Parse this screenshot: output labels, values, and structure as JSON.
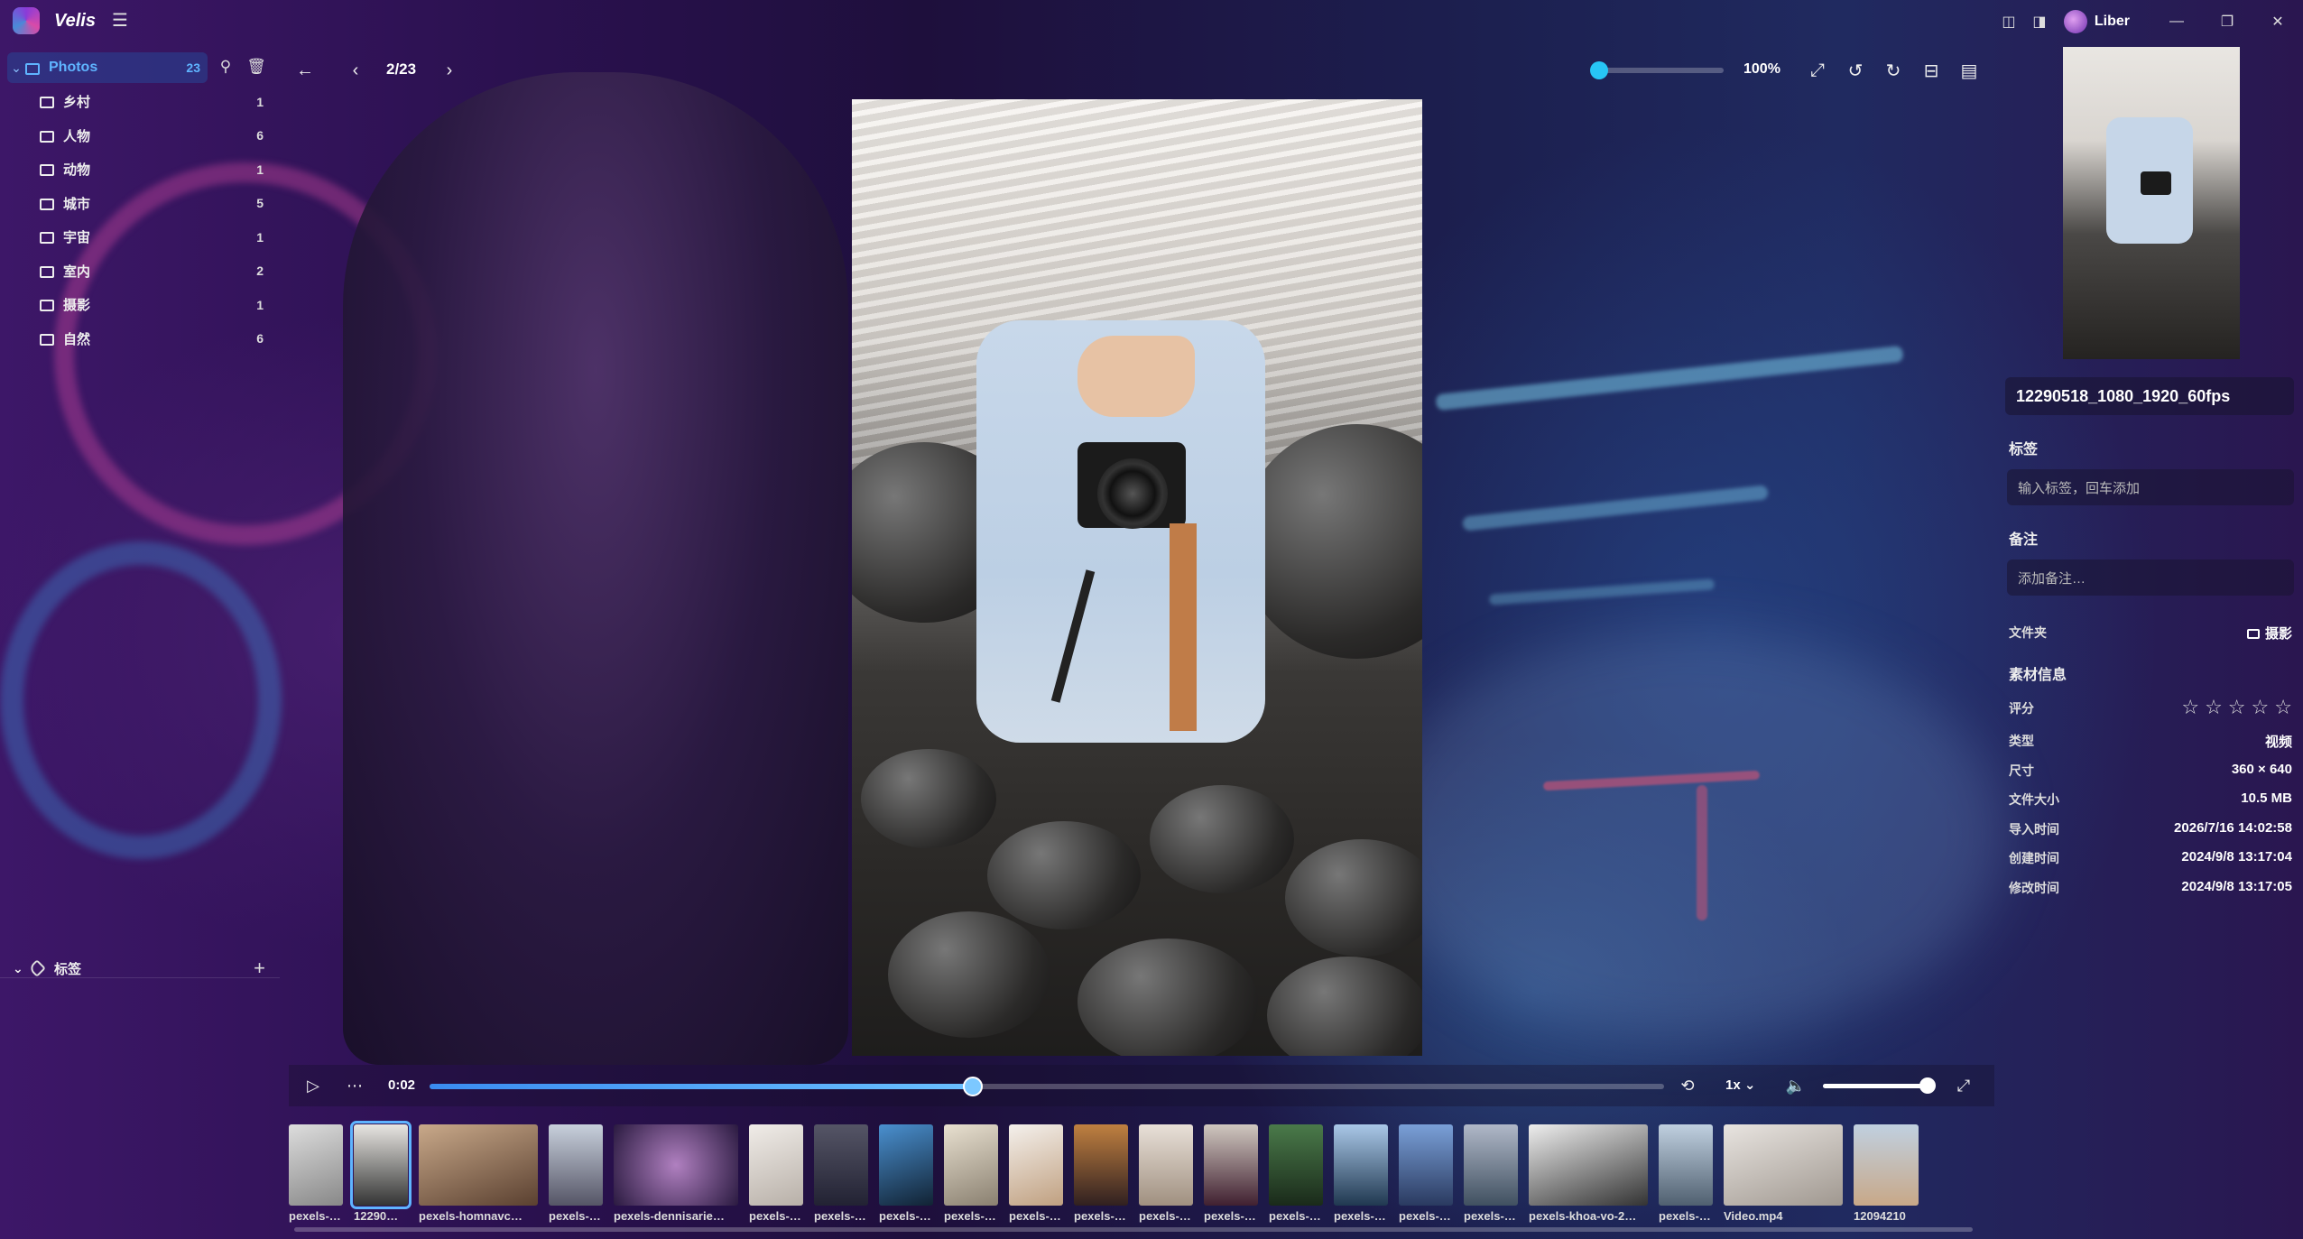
{
  "app": {
    "name": "Velis"
  },
  "user": {
    "name": "Liber"
  },
  "sidebar": {
    "root": {
      "label": "Photos",
      "count": "23"
    },
    "folders": [
      {
        "label": "乡村",
        "count": "1"
      },
      {
        "label": "人物",
        "count": "6"
      },
      {
        "label": "动物",
        "count": "1"
      },
      {
        "label": "城市",
        "count": "5"
      },
      {
        "label": "宇宙",
        "count": "1"
      },
      {
        "label": "室内",
        "count": "2"
      },
      {
        "label": "摄影",
        "count": "1"
      },
      {
        "label": "自然",
        "count": "6"
      }
    ],
    "tags_label": "标签"
  },
  "toolbar": {
    "page": "2/23",
    "zoom": "100%",
    "zoom_level": 0
  },
  "player": {
    "time": "0:02",
    "progress": 0.44,
    "speed": "1x",
    "volume": 0.98
  },
  "filmstrip": [
    {
      "caption": "pexels-…"
    },
    {
      "caption": "12290…"
    },
    {
      "caption": "pexels-homnavc…"
    },
    {
      "caption": "pexels-…"
    },
    {
      "caption": "pexels-dennisarie…"
    },
    {
      "caption": "pexels-…"
    },
    {
      "caption": "pexels-…"
    },
    {
      "caption": "pexels-…"
    },
    {
      "caption": "pexels-…"
    },
    {
      "caption": "pexels-…"
    },
    {
      "caption": "pexels-…"
    },
    {
      "caption": "pexels-…"
    },
    {
      "caption": "pexels-…"
    },
    {
      "caption": "pexels-…"
    },
    {
      "caption": "pexels-…"
    },
    {
      "caption": "pexels-…"
    },
    {
      "caption": "pexels-…"
    },
    {
      "caption": "pexels-khoa-vo-2…"
    },
    {
      "caption": "pexels-…"
    },
    {
      "caption": "Video.mp4"
    },
    {
      "caption": "12094210"
    }
  ],
  "inspector": {
    "title": "12290518_1080_1920_60fps",
    "tags_label": "标签",
    "tags_placeholder": "输入标签，回车添加",
    "notes_label": "备注",
    "notes_placeholder": "添加备注…",
    "folder_label": "文件夹",
    "folder_value": "摄影",
    "info_label": "素材信息",
    "rating_label": "评分",
    "rating": 0,
    "stars": [
      "☆",
      "☆",
      "☆",
      "☆",
      "☆"
    ],
    "info": [
      {
        "k": "类型",
        "v": "视频"
      },
      {
        "k": "尺寸",
        "v": "360 × 640"
      },
      {
        "k": "文件大小",
        "v": "10.5 MB"
      },
      {
        "k": "导入时间",
        "v": "2026/7/16 14:02:58"
      },
      {
        "k": "创建时间",
        "v": "2024/9/8 13:17:04"
      },
      {
        "k": "修改时间",
        "v": "2024/9/8 13:17:05"
      }
    ]
  }
}
